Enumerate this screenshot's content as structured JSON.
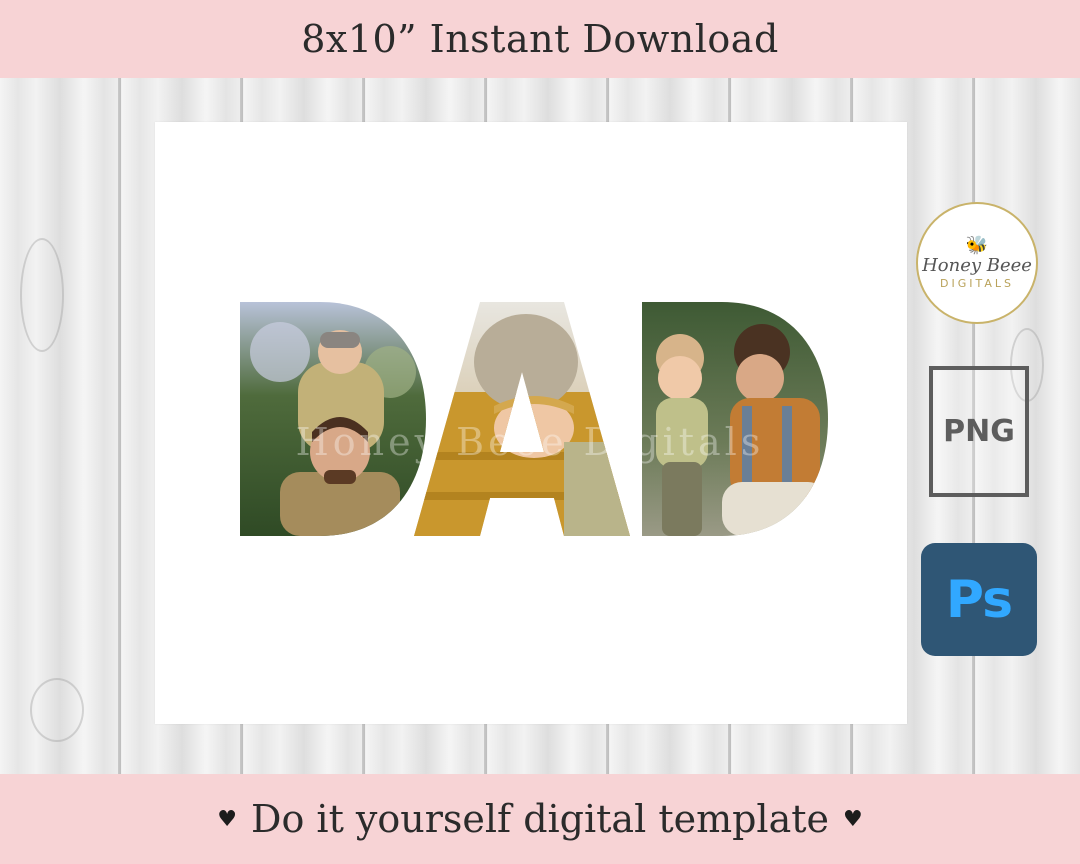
{
  "header": {
    "title": "8x10” Instant Download"
  },
  "footer": {
    "text": "Do it yourself digital template",
    "heart": "♥"
  },
  "artwork": {
    "word_letters": [
      "D",
      "A",
      "D"
    ],
    "watermark": "Honey Beee Digitals"
  },
  "badges": {
    "logo": {
      "name": "Honey Beee",
      "sub": "DIGITALS"
    },
    "png_label": "PNG",
    "ps_label": "Ps"
  },
  "colors": {
    "banner": "#f7d3d5",
    "ps_bg": "#2f5675",
    "ps_text": "#31a8ff",
    "logo_ring": "#c9b36a"
  }
}
